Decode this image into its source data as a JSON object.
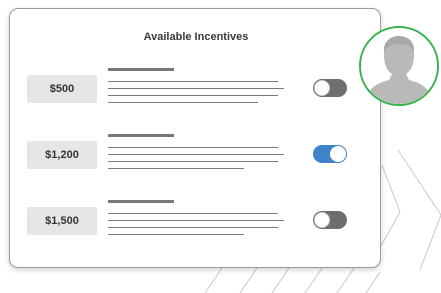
{
  "panel": {
    "title": "Available Incentives"
  },
  "incentives": [
    {
      "amount": "$500",
      "enabled": false
    },
    {
      "amount": "$1,200",
      "enabled": true
    },
    {
      "amount": "$1,500",
      "enabled": false
    }
  ],
  "colors": {
    "toggle_on": "#3f84c9",
    "toggle_off": "#6e6e6e",
    "avatar_ring": "#38b24a",
    "amount_chip": "#e6e6e6"
  },
  "icons": {
    "avatar": "user-silhouette-icon"
  }
}
